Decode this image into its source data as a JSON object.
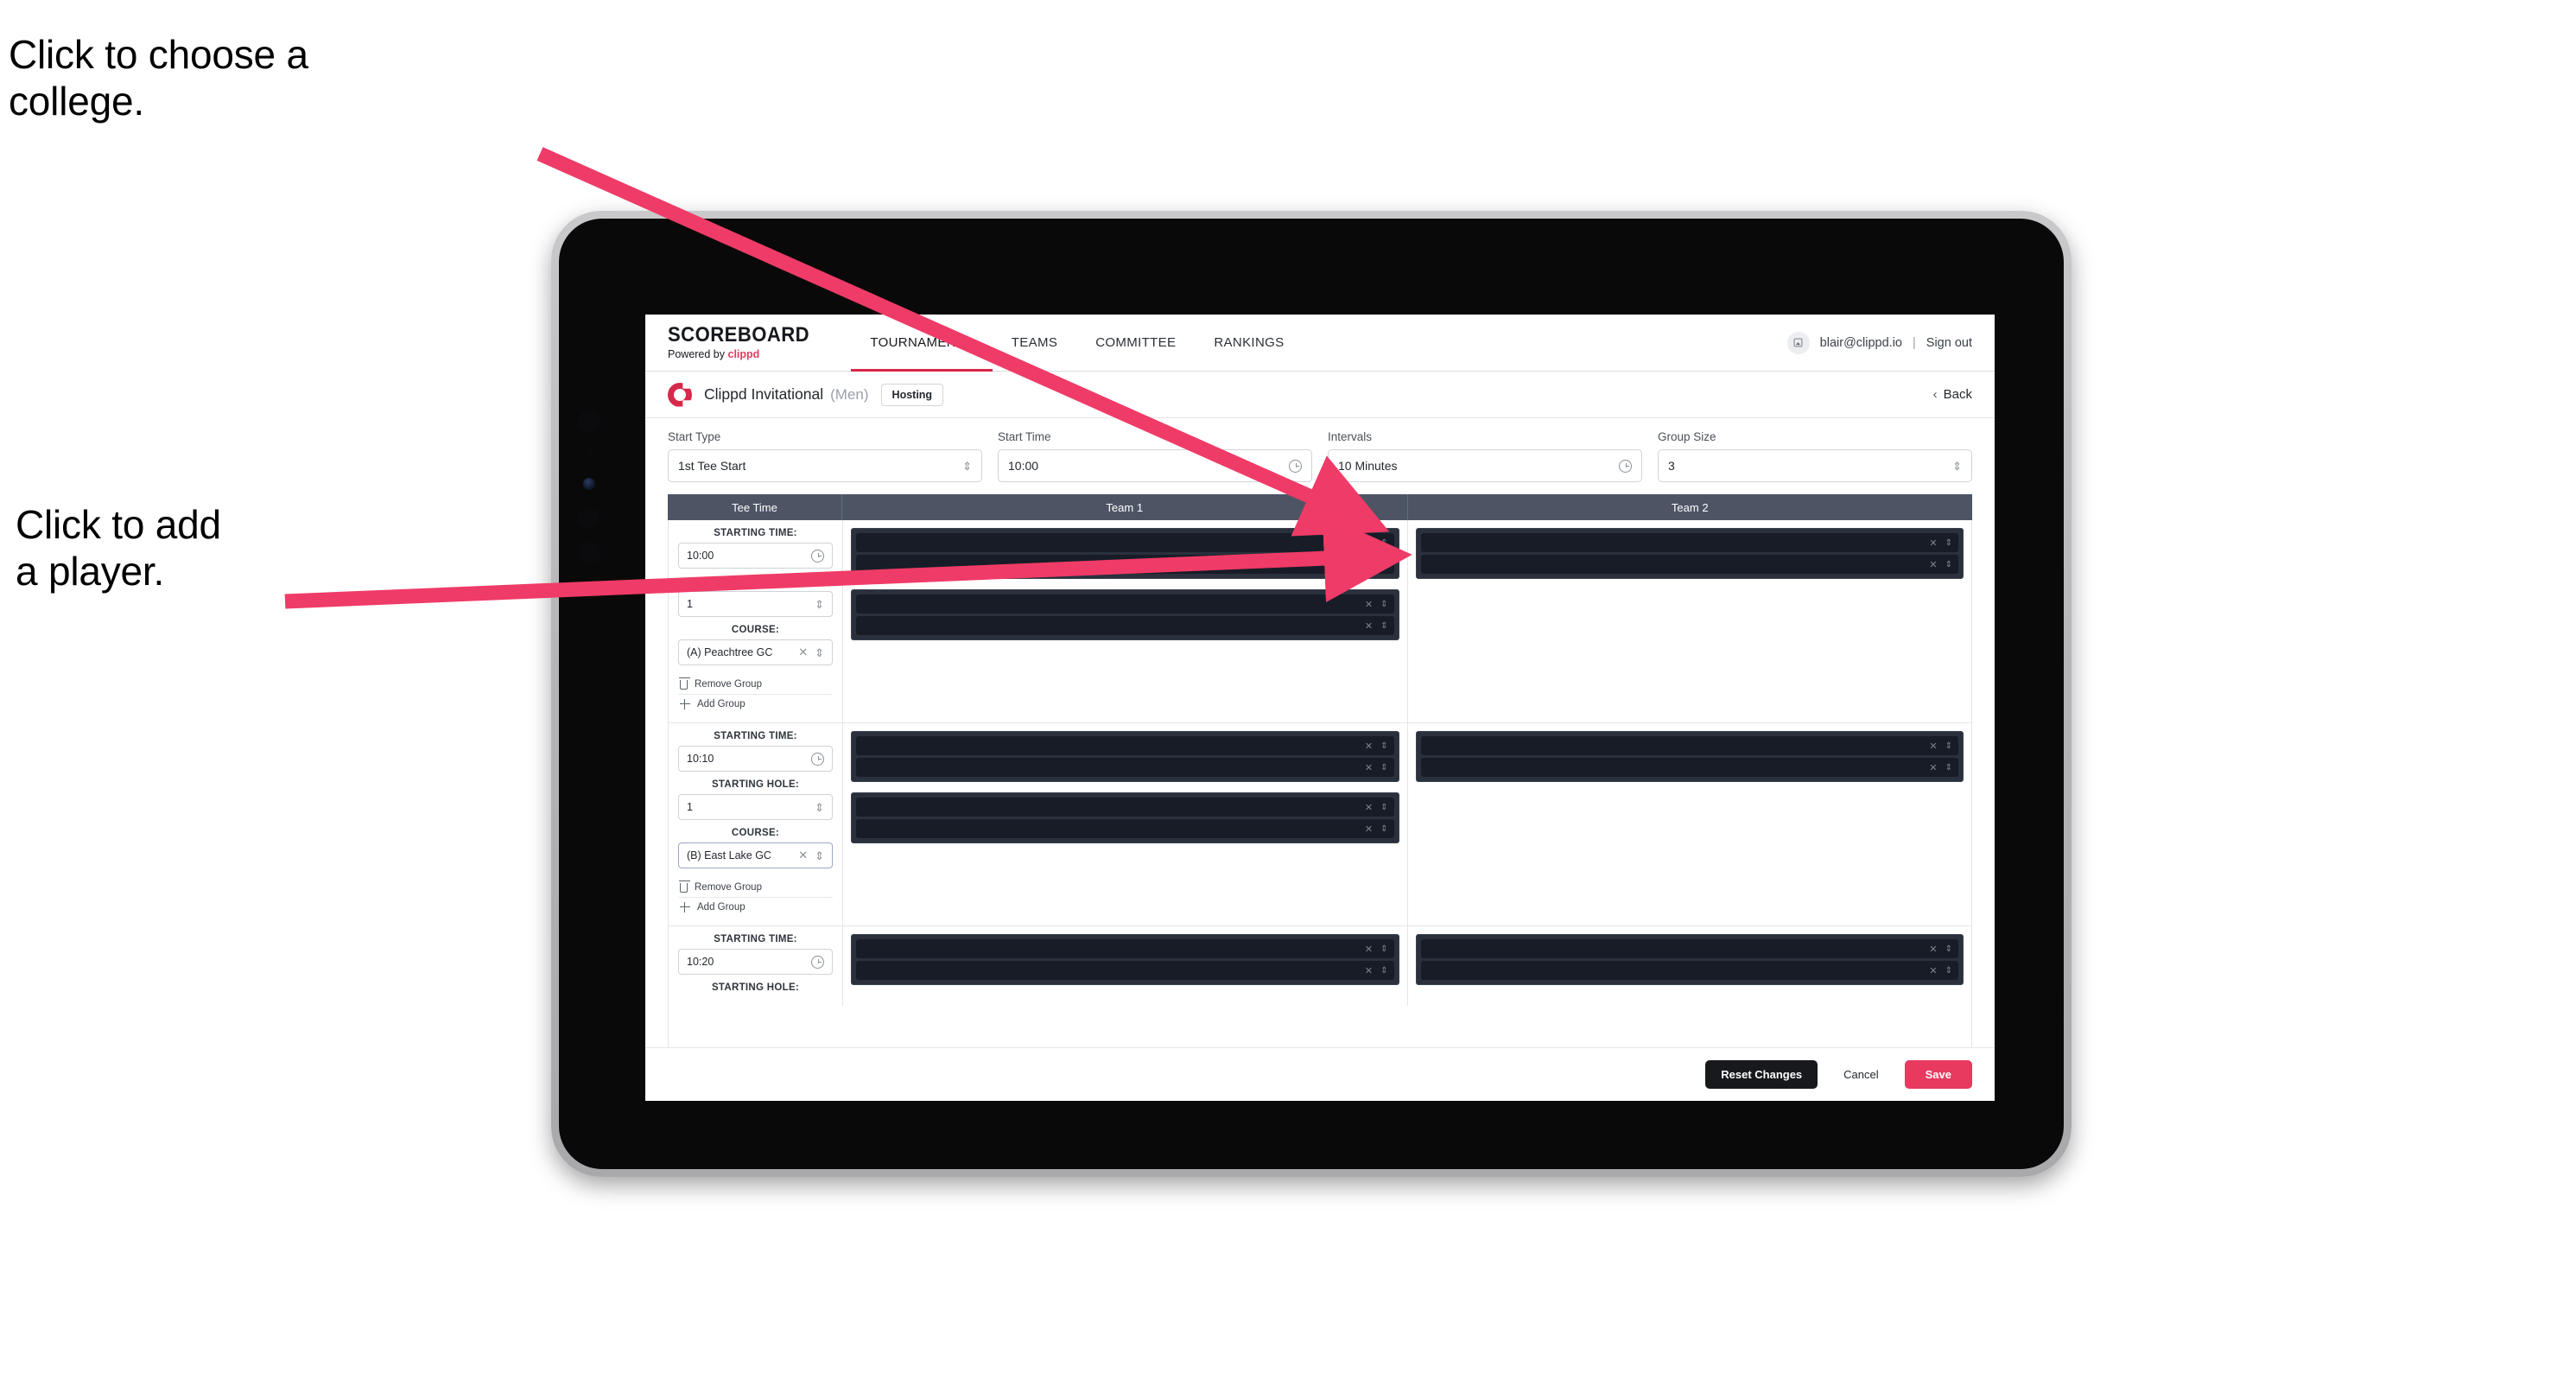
{
  "annotations": [
    {
      "id": "college",
      "text": "Click to choose a\ncollege."
    },
    {
      "id": "player",
      "text": "Click to add\na player."
    }
  ],
  "colors": {
    "accent": "#e8395f",
    "nav_active_underline": "#d6294b",
    "table_header_bg": "#4d5565",
    "player_block_bg": "#2a303c",
    "player_row_bg": "#171c27",
    "annotation_arrow": "#ef3b67",
    "reset_button_bg": "#17191c"
  },
  "topnav": {
    "brand_main": "SCOREBOARD",
    "brand_sub_prefix": "Powered by",
    "brand_sub_name": "clippd",
    "tabs": [
      {
        "label": "TOURNAMENTS",
        "active": true
      },
      {
        "label": "TEAMS",
        "active": false
      },
      {
        "label": "COMMITTEE",
        "active": false
      },
      {
        "label": "RANKINGS",
        "active": false
      }
    ],
    "avatar_icon": "user-avatar-icon",
    "user_email": "blair@clippd.io",
    "separator": "|",
    "sign_out": "Sign out"
  },
  "tournament_bar": {
    "logo_icon": "clippd-c-logo",
    "name": "Clippd Invitational",
    "gender": "(Men)",
    "badge": "Hosting",
    "back_label": "Back",
    "back_icon": "chevron-left-icon"
  },
  "controls": [
    {
      "label": "Start Type",
      "value": "1st Tee Start",
      "indicator": "stepper-icon"
    },
    {
      "label": "Start Time",
      "value": "10:00",
      "indicator": "clock-icon"
    },
    {
      "label": "Intervals",
      "value": "10 Minutes",
      "indicator": "clock-icon"
    },
    {
      "label": "Group Size",
      "value": "3",
      "indicator": "stepper-icon"
    }
  ],
  "table": {
    "headers": {
      "tee_time": "Tee Time",
      "team1": "Team 1",
      "team2": "Team 2"
    },
    "field_labels": {
      "starting_time": "STARTING TIME:",
      "starting_hole": "STARTING HOLE:",
      "course": "COURSE:"
    },
    "actions": {
      "remove_group": "Remove Group",
      "add_group": "Add Group"
    },
    "groups": [
      {
        "starting_time": "10:00",
        "starting_hole": "1",
        "course": "(A) Peachtree GC",
        "course_focused": false,
        "team1_blocks": [
          2,
          2
        ],
        "team2_blocks": [
          2
        ]
      },
      {
        "starting_time": "10:10",
        "starting_hole": "1",
        "course": "(B) East Lake GC",
        "course_focused": true,
        "team1_blocks": [
          2,
          2
        ],
        "team2_blocks": [
          2
        ]
      },
      {
        "starting_time": "10:20",
        "starting_hole": "",
        "course": "",
        "course_focused": false,
        "team1_blocks": [
          2
        ],
        "team2_blocks": [
          2
        ]
      }
    ],
    "row_icons": {
      "clear": "close-x-icon",
      "stepper": "stepper-icon"
    }
  },
  "footer": {
    "reset": "Reset Changes",
    "cancel": "Cancel",
    "save": "Save"
  }
}
